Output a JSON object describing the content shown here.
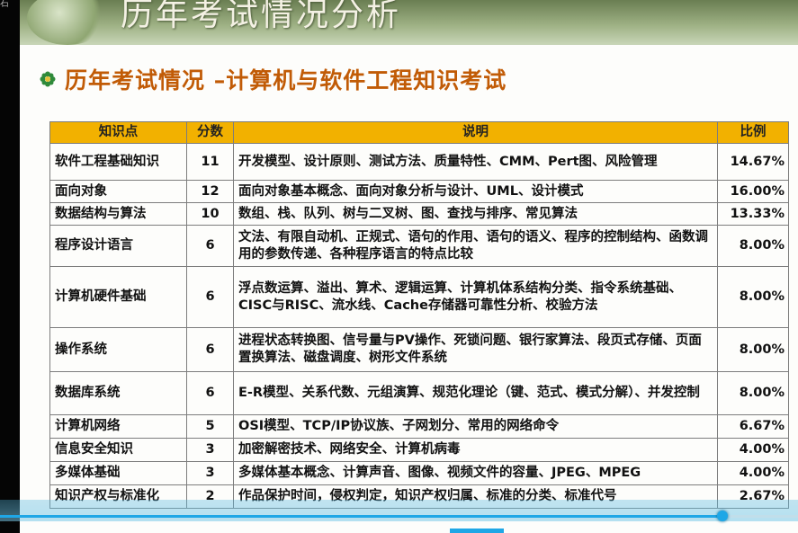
{
  "left_glyph": "石",
  "banner": {
    "title": "历年考试情况分析"
  },
  "subtitle": {
    "bullet_icon": "flower-bullet-icon",
    "text": "历年考试情况 –计算机与软件工程知识考试"
  },
  "table": {
    "headers": [
      "知识点",
      "分数",
      "说明",
      "比例"
    ],
    "rows": [
      {
        "name": "软件工程基础知识",
        "score": "11",
        "desc": "开发模型、设计原则、测试方法、质量特性、CMM、Pert图、风险管理",
        "ratio": "14.67%"
      },
      {
        "name": "面向对象",
        "score": "12",
        "desc": "面向对象基本概念、面向对象分析与设计、UML、设计模式",
        "ratio": "16.00%"
      },
      {
        "name": "数据结构与算法",
        "score": "10",
        "desc": "数组、栈、队列、树与二叉树、图、查找与排序、常见算法",
        "ratio": "13.33%"
      },
      {
        "name": "程序设计语言",
        "score": "6",
        "desc": "文法、有限自动机、正规式、语句的作用、语句的语义、程序的控制结构、函数调用的参数传递、各种程序语言的特点比较",
        "ratio": "8.00%"
      },
      {
        "name": "计算机硬件基础",
        "score": "6",
        "desc": "浮点数运算、溢出、算术、逻辑运算、计算机体系结构分类、指令系统基础、CISC与RISC、流水线、Cache存储器可靠性分析、校验方法",
        "ratio": "8.00%"
      },
      {
        "name": "操作系统",
        "score": "6",
        "desc": "进程状态转换图、信号量与PV操作、死锁问题、银行家算法、段页式存储、页面置换算法、磁盘调度、树形文件系统",
        "ratio": "8.00%"
      },
      {
        "name": "数据库系统",
        "score": "6",
        "desc": "E-R模型、关系代数、元组演算、规范化理论（键、范式、模式分解）、并发控制",
        "ratio": "8.00%"
      },
      {
        "name": "计算机网络",
        "score": "5",
        "desc": "OSI模型、TCP/IP协议族、子网划分、常用的网络命令",
        "ratio": "6.67%"
      },
      {
        "name": "信息安全知识",
        "score": "3",
        "desc": "加密解密技术、网络安全、计算机病毒",
        "ratio": "4.00%"
      },
      {
        "name": "多媒体基础",
        "score": "3",
        "desc": "多媒体基本概念、计算声音、图像、视频文件的容量、JPEG、MPEG",
        "ratio": "4.00%"
      },
      {
        "name": "知识产权与标准化",
        "score": "2",
        "desc": "作品保护时间，侵权判定，知识产权归属、标准的分类、标准代号",
        "ratio": "2.67%"
      }
    ]
  },
  "player": {
    "progress_fraction": 0.905
  },
  "colors": {
    "header_bg": "#f2b100",
    "subtitle": "#c15b06",
    "accent": "#1fa7e6"
  }
}
